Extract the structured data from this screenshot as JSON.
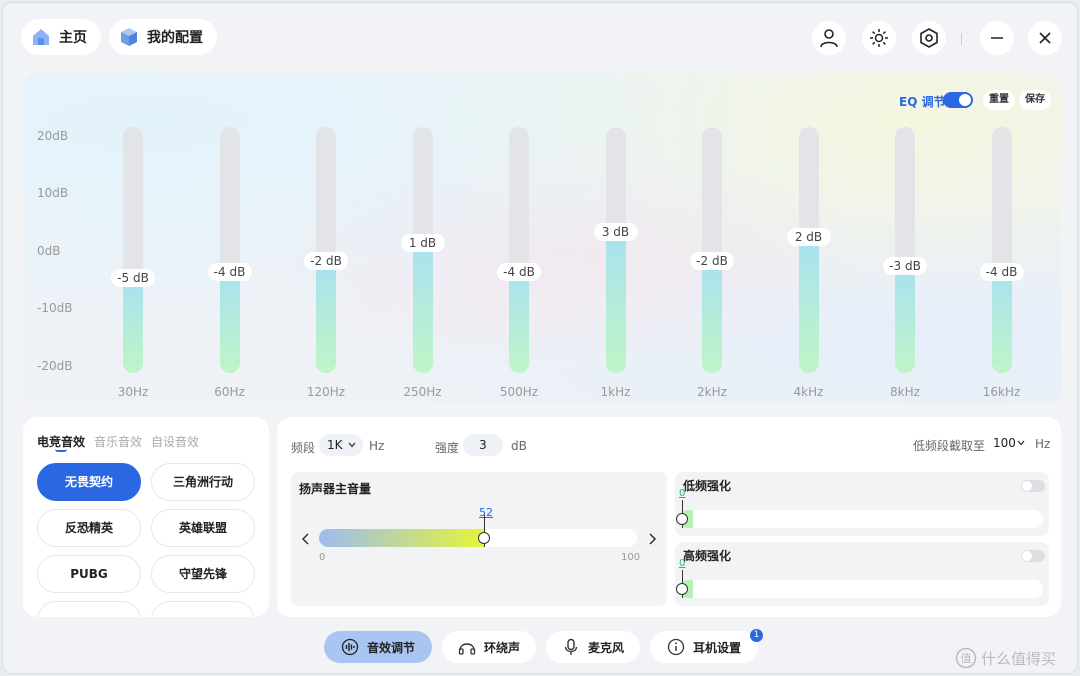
{
  "header": {
    "home_label": "主页",
    "config_label": "我的配置"
  },
  "eq": {
    "toggle_label": "EQ 调节",
    "toggle_on": true,
    "reset_label": "重置",
    "save_label": "保存",
    "y_labels": [
      "20dB",
      "10dB",
      "0dB",
      "-10dB",
      "-20dB"
    ],
    "bands": [
      {
        "freq": "30Hz",
        "label": "-5 dB",
        "db": -5
      },
      {
        "freq": "60Hz",
        "label": "-4 dB",
        "db": -4
      },
      {
        "freq": "120Hz",
        "label": "-2 dB",
        "db": -2
      },
      {
        "freq": "250Hz",
        "label": "1 dB",
        "db": 1
      },
      {
        "freq": "500Hz",
        "label": "-4 dB",
        "db": -4
      },
      {
        "freq": "1kHz",
        "label": "3 dB",
        "db": 3
      },
      {
        "freq": "2kHz",
        "label": "-2 dB",
        "db": -2
      },
      {
        "freq": "4kHz",
        "label": "2 dB",
        "db": 2
      },
      {
        "freq": "8kHz",
        "label": "-3 dB",
        "db": -3
      },
      {
        "freq": "16kHz",
        "label": "-4 dB",
        "db": -4
      }
    ]
  },
  "presets": {
    "tabs": [
      "电竞音效",
      "音乐音效",
      "自设音效"
    ],
    "items": [
      "无畏契约",
      "三角洲行动",
      "反恐精英",
      "英雄联盟",
      "PUBG",
      "守望先锋"
    ],
    "active_index": 0
  },
  "settings": {
    "band_label": "频段",
    "band_value": "1K",
    "band_unit": "Hz",
    "strength_label": "强度",
    "strength_value": "3",
    "strength_unit": "dB",
    "lowcut_label": "低频段截取至",
    "lowcut_value": "100",
    "lowcut_unit": "Hz",
    "master_title": "扬声器主音量",
    "master_value": "52",
    "master_min": "0",
    "master_max": "100",
    "bass_title": "低频强化",
    "bass_value": "0",
    "treble_title": "高频强化",
    "treble_value": "0"
  },
  "nav": {
    "items": [
      "音效调节",
      "环绕声",
      "麦克风",
      "耳机设置"
    ],
    "active_index": 0,
    "badge": "1"
  },
  "watermark": "什么值得买"
}
